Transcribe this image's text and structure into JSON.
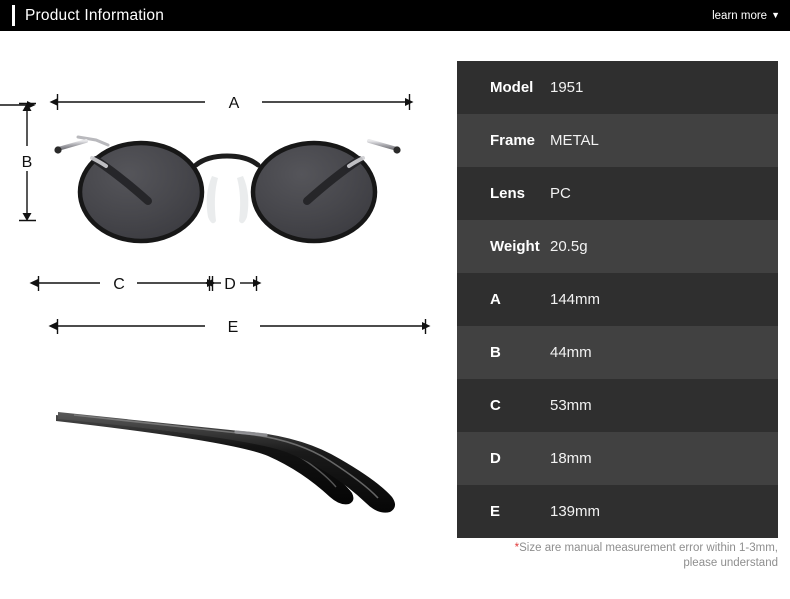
{
  "header": {
    "title": "Product Information",
    "learn_more_label": "learn more",
    "caret_icon": "chevron-down-icon",
    "caret_glyph": "▼",
    "background_color": "#000000",
    "accent_color": "#ffffff"
  },
  "diagram": {
    "front_view": {
      "name": "sunglasses-front-view",
      "description": "Oval black metal frame sunglasses, front view, dark tinted lenses"
    },
    "side_view": {
      "name": "sunglasses-temple-side-view",
      "description": "Black temple arms side view with rounded tips"
    },
    "dimension_labels": {
      "a": "A",
      "b": "B",
      "c": "C",
      "d": "D",
      "e": "E"
    }
  },
  "spec_table": {
    "row_color_dark": "#2f2f2f",
    "row_color_light": "#414141",
    "rows": [
      {
        "label": "Model",
        "value": "1951"
      },
      {
        "label": "Frame",
        "value": "METAL"
      },
      {
        "label": "Lens",
        "value": "PC"
      },
      {
        "label": "Weight",
        "value": "20.5g"
      },
      {
        "label": "A",
        "value": "144mm"
      },
      {
        "label": "B",
        "value": "44mm"
      },
      {
        "label": "C",
        "value": "53mm"
      },
      {
        "label": "D",
        "value": "18mm"
      },
      {
        "label": "E",
        "value": "139mm"
      }
    ],
    "note": {
      "asterisk": "*",
      "line1": "Size are manual measurement error within 1-3mm,",
      "line2": "please understand",
      "asterisk_color": "#e03a3a"
    }
  }
}
